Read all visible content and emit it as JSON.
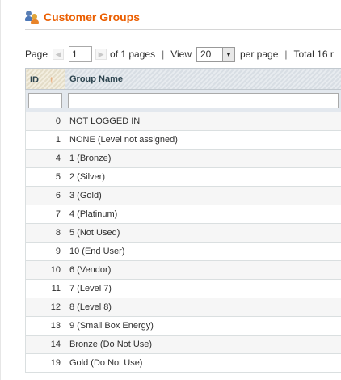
{
  "header": {
    "title": "Customer Groups",
    "icon": "customer-groups-icon"
  },
  "pager": {
    "page_label": "Page",
    "current_page": "1",
    "of_pages": "of 1 pages",
    "separator": "|",
    "view_label": "View",
    "per_page_value": "20",
    "per_page_label": "per page",
    "total_label": "Total 16 r"
  },
  "grid": {
    "columns": [
      {
        "label": "ID",
        "sorted": "asc"
      },
      {
        "label": "Group Name"
      }
    ],
    "sort_arrow": "↑",
    "rows": [
      {
        "id": "0",
        "name": "NOT LOGGED IN"
      },
      {
        "id": "1",
        "name": "NONE (Level not assigned)"
      },
      {
        "id": "4",
        "name": "1 (Bronze)"
      },
      {
        "id": "5",
        "name": "2 (Silver)"
      },
      {
        "id": "6",
        "name": "3 (Gold)"
      },
      {
        "id": "7",
        "name": "4 (Platinum)"
      },
      {
        "id": "8",
        "name": "5 (Not Used)"
      },
      {
        "id": "9",
        "name": "10 (End User)"
      },
      {
        "id": "10",
        "name": "6 (Vendor)"
      },
      {
        "id": "11",
        "name": "7 (Level 7)"
      },
      {
        "id": "12",
        "name": "8 (Level 8)"
      },
      {
        "id": "13",
        "name": "9 (Small Box Energy)"
      },
      {
        "id": "14",
        "name": "Bronze (Do Not Use)"
      },
      {
        "id": "19",
        "name": "Gold (Do Not Use)"
      }
    ]
  },
  "colors": {
    "title": "#eb5e00",
    "header_bg": "#dfe4e9",
    "filter_bg": "#e3e8ee",
    "odd_row_bg": "#f6f6f6"
  }
}
